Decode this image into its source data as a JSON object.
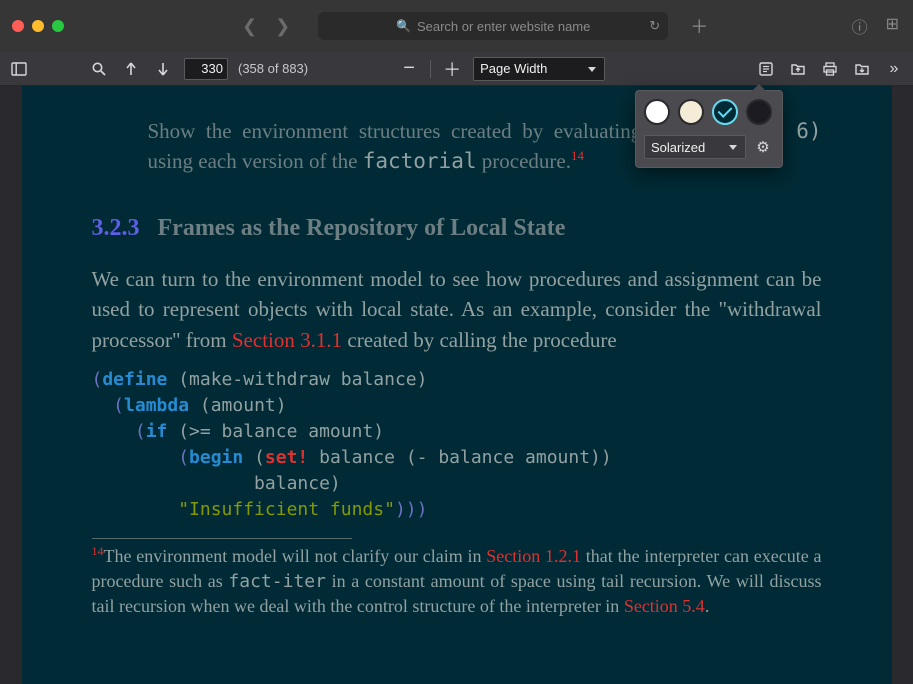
{
  "browser": {
    "url_placeholder": "Search or enter website name"
  },
  "pdf_toolbar": {
    "page_number": "330",
    "page_count": "(358 of 883)",
    "zoom_label": "Page Width"
  },
  "theme_popover": {
    "swatches": [
      {
        "color": "#ffffff",
        "selected": false
      },
      {
        "color": "#f5ecd8",
        "selected": false
      },
      {
        "color": "#002b36",
        "selected": true
      },
      {
        "color": "#1c1b22",
        "selected": false
      }
    ],
    "theme_name": "Solarized"
  },
  "document": {
    "exercise_line1_a": "Show the environment structures created by evaluating ",
    "exercise_code1": "(factorial 6)",
    "exercise_line1_b": " using each version of the ",
    "exercise_code2": "factorial",
    "exercise_line1_c": " procedure.",
    "exercise_sup": "14",
    "section_number": "3.2.3",
    "section_title": "Frames as the Repository of Local State",
    "para1_a": "We can turn to the environment model to see how procedures and assignment can be used to represent objects with local state. As an example, consider the \"withdrawal processor\" from ",
    "para1_link": "Section 3.1.1",
    "para1_b": " created by calling the procedure",
    "code": {
      "l1a": "(",
      "l1_def": "define",
      "l1b": " (make-withdraw balance)",
      "l2a": "  (",
      "l2_lambda": "lambda",
      "l2b": " (amount)",
      "l3a": "    (",
      "l3_if": "if",
      "l3b": " (>= balance amount)",
      "l4a": "        (",
      "l4_begin": "begin",
      "l4b": " (",
      "l4_set": "set!",
      "l4c": " balance (- balance amount))",
      "l5": "               balance)",
      "l6a": "        ",
      "l6_str": "\"Insufficient funds\"",
      "l6b": ")))"
    },
    "footnote_sup": "14",
    "footnote_a": "The environment model will not clarify our claim in ",
    "footnote_link1": "Section 1.2.1",
    "footnote_b": " that the interpreter can execute a procedure such as ",
    "footnote_code": "fact-iter",
    "footnote_c": " in a constant amount of space using tail recursion. We will discuss tail recursion when we deal with the control structure of the interpreter in ",
    "footnote_link2": "Section 5.4",
    "footnote_d": "."
  }
}
